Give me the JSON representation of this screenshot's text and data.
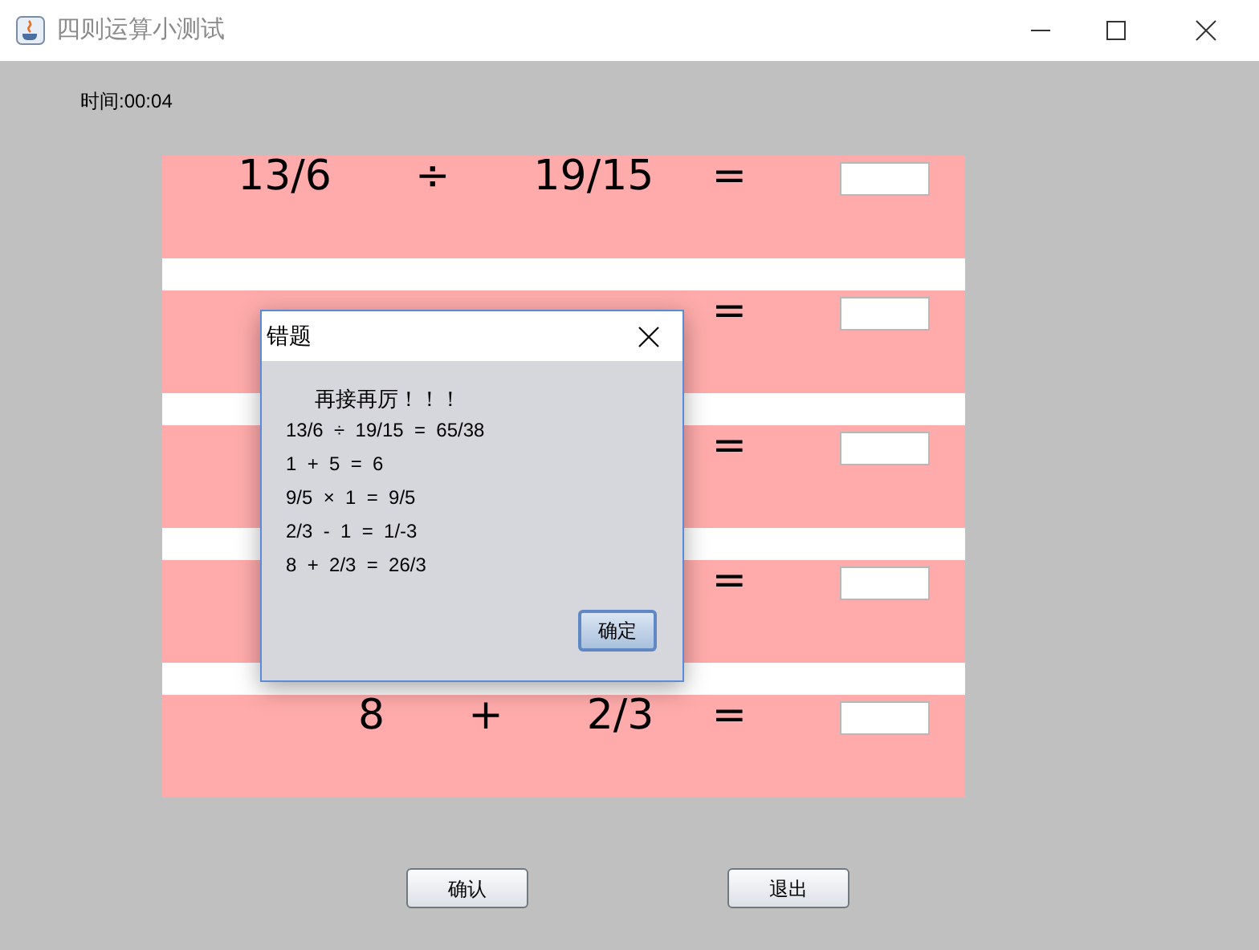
{
  "window": {
    "title": "四则运算小测试"
  },
  "timer": "时间:00:04",
  "questions": [
    {
      "operand_1": "13/6",
      "operator": "÷",
      "operand_2": "19/15",
      "equals": "="
    },
    {
      "equals": "="
    },
    {
      "equals": "="
    },
    {
      "equals": "="
    },
    {
      "operand_1": "8",
      "operator": "+",
      "operand_2": "2/3",
      "equals": "="
    }
  ],
  "buttons": [
    "确认",
    "退出"
  ],
  "dialog": {
    "title": "错题",
    "message": "再接再厉！！！",
    "lines": [
      "13/6  ÷  19/15  =  65/38",
      "1  +  5  =  6",
      "9/5  ×  1  =  9/5",
      "2/3  -  1  =  1/-3",
      "8  +  2/3  =  26/3"
    ],
    "button": "确定"
  }
}
